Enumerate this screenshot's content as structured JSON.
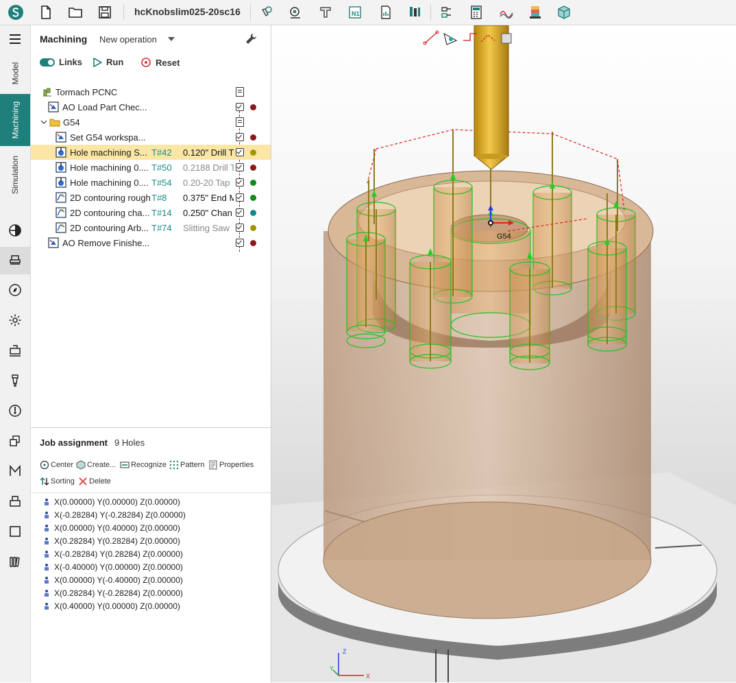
{
  "toolbar": {
    "title": "hcKnobslim025-20sc16",
    "icons": [
      "app-logo-icon",
      "new-file-icon",
      "open-folder-icon",
      "save-icon",
      "magnet-icon",
      "part-setup-icon",
      "fixture-icon",
      "nc-program-icon",
      "report-icon",
      "tools-icon",
      "toggle-icon",
      "calculator-icon",
      "graph-icon",
      "stock-icon",
      "cube-icon"
    ]
  },
  "rail": {
    "tabs": [
      "Model",
      "Machining",
      "Simulation"
    ],
    "active_tab": "Machining"
  },
  "panel": {
    "title": "Machining",
    "new_operation": "New operation",
    "actions": {
      "links": "Links",
      "run": "Run",
      "reset": "Reset"
    }
  },
  "tree": {
    "machine": "Tormach PCNC",
    "load_part": "AO Load Part Chec...",
    "workspace": "G54",
    "set_workspace": "Set G54 workspa...",
    "ops": [
      {
        "label": "Hole machining S...",
        "tool_no": "T#42",
        "tool": "0.120\" Drill T",
        "status": "#a39500",
        "selected": true,
        "dim": false
      },
      {
        "label": "Hole machining 0....",
        "tool_no": "T#50",
        "tool": "0.2188 Drill T",
        "status": "#8a1a1a",
        "selected": false,
        "dim": true
      },
      {
        "label": "Hole machining 0....",
        "tool_no": "T#54",
        "tool": "0.20-20 Tap",
        "status": "#0e8a1e",
        "selected": false,
        "dim": true
      },
      {
        "label": "2D contouring rough",
        "tool_no": "T#8",
        "tool": "0.375\" End M",
        "status": "#0e8a1e",
        "selected": false,
        "dim": false
      },
      {
        "label": "2D contouring cha...",
        "tool_no": "T#14",
        "tool": "0.250\" Chan",
        "status": "#118a8a",
        "selected": false,
        "dim": false
      },
      {
        "label": "2D contouring Arb...",
        "tool_no": "T#74",
        "tool": "Slitting Saw",
        "status": "#a39500",
        "selected": false,
        "dim": true
      }
    ],
    "remove_part": "AO Remove Finishe...",
    "colors": {
      "load": "#8a1a1a",
      "setws": "#8a1a1a",
      "remove": "#8a1a1a"
    }
  },
  "job": {
    "title": "Job assignment",
    "count": "9 Holes",
    "buttons": {
      "center": "Center",
      "create": "Create...",
      "recognize": "Recognize",
      "pattern": "Pattern",
      "properties": "Properties",
      "sorting": "Sorting",
      "delete": "Delete"
    },
    "points": [
      "X(0.00000) Y(0.00000) Z(0.00000)",
      "X(-0.28284) Y(-0.28284) Z(0.00000)",
      "X(0.00000) Y(0.40000) Z(0.00000)",
      "X(0.28284) Y(0.28284) Z(0.00000)",
      "X(-0.28284) Y(0.28284) Z(0.00000)",
      "X(-0.40000) Y(0.00000) Z(0.00000)",
      "X(0.00000) Y(-0.40000) Z(0.00000)",
      "X(0.28284) Y(-0.28284) Z(0.00000)",
      "X(0.40000) Y(0.00000) Z(0.00000)"
    ]
  },
  "viewport": {
    "origin_label": "G54",
    "axis_z": "Z",
    "axis_y": "Y",
    "axis_x": "X"
  }
}
